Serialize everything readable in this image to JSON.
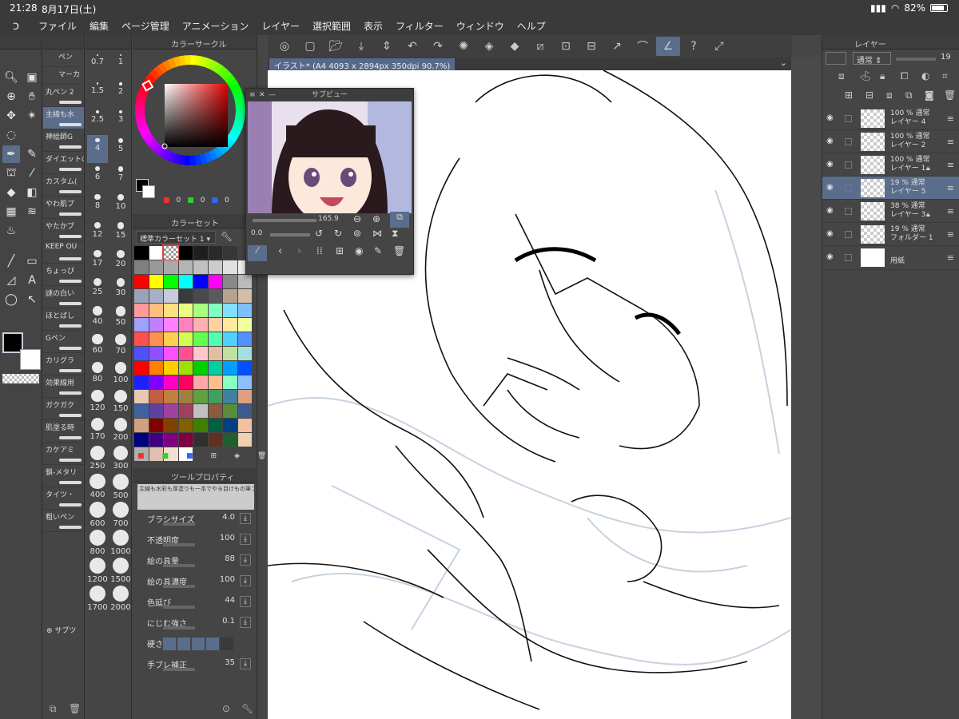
{
  "status": {
    "time": "21:28",
    "date": "8月17日(土)",
    "battery": "82%"
  },
  "menu": [
    "ファイル",
    "編集",
    "ページ管理",
    "アニメーション",
    "レイヤー",
    "選択範囲",
    "表示",
    "フィルター",
    "ウィンドウ",
    "ヘルプ"
  ],
  "tools": {
    "subtool_tabs": [
      "ペン",
      "マーカ"
    ],
    "subtools": [
      "丸ペン 2",
      "主線も水",
      "神絵師G",
      "ダイエットの",
      "カスタム(",
      "やわ肌ブ",
      "やたかブ",
      "KEEP OU",
      "ちょっぴ",
      "謎の白い",
      "ほとばし",
      "Gペン",
      "カリグラ",
      "効果線用",
      "ガクガク",
      "肌塗る時",
      "カケアミ",
      "鎖-メタリ",
      "タイツ・",
      "粗いペン"
    ],
    "subview_btn": "サブツ"
  },
  "sizes": [
    "0.7",
    "1",
    "1.5",
    "2",
    "2.5",
    "3",
    "4",
    "5",
    "6",
    "7",
    "8",
    "10",
    "12",
    "15",
    "17",
    "20",
    "25",
    "30",
    "40",
    "50",
    "60",
    "70",
    "80",
    "100",
    "120",
    "150",
    "170",
    "200",
    "250",
    "300",
    "400",
    "500",
    "600",
    "700",
    "800",
    "1000",
    "1200",
    "1500",
    "1700",
    "2000"
  ],
  "color_circle": {
    "title": "カラーサークル",
    "r": "0",
    "g": "0",
    "b": "0"
  },
  "color_set": {
    "title": "カラーセット",
    "preset": "標準カラーセット 1"
  },
  "palette": [
    "#000000",
    "#ffffff",
    "#cccccc",
    "#000000",
    "#1e1e1e",
    "#2a2a2a",
    "#363636",
    "#424242",
    "#808080",
    "#999999",
    "#aaaaaa",
    "#b4b4b4",
    "#c0c0c0",
    "#cccccc",
    "#e0e0e0",
    "#eeeeee",
    "#ff0000",
    "#ffff00",
    "#00ff00",
    "#00ffff",
    "#0000ff",
    "#ff00ff",
    "#888888",
    "#bbbbbb",
    "#9ca3b8",
    "#a8b0c8",
    "#c6cad9",
    "#3a3a3a",
    "#4a4a4a",
    "#5a5a5a",
    "#b7a48e",
    "#d2bfa8",
    "#ff9a9a",
    "#ffbf80",
    "#ffe080",
    "#e8ff80",
    "#a8ff80",
    "#80ffbf",
    "#80e0ff",
    "#80bfff",
    "#a0a0ff",
    "#c080ff",
    "#ff80ff",
    "#ff80c0",
    "#ffb0b0",
    "#ffd0a0",
    "#ffe8a0",
    "#f0ffa0",
    "#ff5050",
    "#ff9050",
    "#ffd050",
    "#d0ff50",
    "#60ff50",
    "#50ffb0",
    "#50d0ff",
    "#5090ff",
    "#5050ff",
    "#9050ff",
    "#ff50ff",
    "#ff5090",
    "#ffc8c8",
    "#e0c0a0",
    "#c0e0a0",
    "#a0e0e0",
    "#ff0000",
    "#ff8000",
    "#ffd000",
    "#a0e000",
    "#00d000",
    "#00d0a0",
    "#00a0ff",
    "#0050ff",
    "#2020ff",
    "#8000ff",
    "#ff00c0",
    "#ff0060",
    "#ffa8a8",
    "#ffbf8c",
    "#8cffbf",
    "#8cbfff",
    "#e8c8b0",
    "#c06040",
    "#c08040",
    "#a08040",
    "#60a040",
    "#40a060",
    "#4080a0",
    "#e0a080",
    "#4060a0",
    "#6040a0",
    "#a040a0",
    "#a04060",
    "#c0c0c0",
    "#8c5a3c",
    "#5a8c3c",
    "#3c5a8c",
    "#d0a080",
    "#800000",
    "#804000",
    "#806000",
    "#408000",
    "#006040",
    "#004080",
    "#f4c0a0",
    "#000080",
    "#400080",
    "#800080",
    "#800040",
    "#303030",
    "#603020",
    "#206030",
    "#f0d0b0",
    "#b0b0b0",
    "#e0c0b0",
    "#f0e0d0",
    "#ffffff"
  ],
  "tool_property": {
    "title": "ツールプロパティ",
    "preset": "主線も水彩も厚塗りも一本でやる目けもの筆ブラシ",
    "rows": [
      {
        "label": "ブラシサイズ",
        "value": "4.0"
      },
      {
        "label": "不透明度",
        "value": "100"
      },
      {
        "label": "絵の具量",
        "value": "88"
      },
      {
        "label": "絵の具濃度",
        "value": "100"
      },
      {
        "label": "色延び",
        "value": "44"
      },
      {
        "label": "にじむ強さ",
        "value": "0.1"
      },
      {
        "label": "硬さ",
        "value": ""
      },
      {
        "label": "手ブレ補正",
        "value": "35"
      }
    ]
  },
  "document": {
    "tab": "イラスト* (A4 4093 x 2894px 350dpi 90.7%)"
  },
  "subview": {
    "title": "サブビュー",
    "zoom": "165.9",
    "rotate": "0.0"
  },
  "layers": {
    "title": "レイヤー",
    "blend": "通常",
    "opacity": "19",
    "items": [
      {
        "opacity": "100 %",
        "mode": "通常",
        "name": "レイヤー 4",
        "active": false,
        "locked": false
      },
      {
        "opacity": "100 %",
        "mode": "通常",
        "name": "レイヤー 2",
        "active": false,
        "locked": false
      },
      {
        "opacity": "100 %",
        "mode": "通常",
        "name": "レイヤー 1",
        "active": false,
        "locked": true
      },
      {
        "opacity": "19 %",
        "mode": "通常",
        "name": "レイヤー 5",
        "active": true,
        "locked": false
      },
      {
        "opacity": "38 %",
        "mode": "通常",
        "name": "レイヤー 3",
        "active": false,
        "locked": true
      },
      {
        "opacity": "19 %",
        "mode": "通常",
        "name": "フォルダー 1",
        "active": false,
        "locked": false
      },
      {
        "opacity": "",
        "mode": "",
        "name": "用紙",
        "active": false,
        "locked": false
      }
    ]
  }
}
